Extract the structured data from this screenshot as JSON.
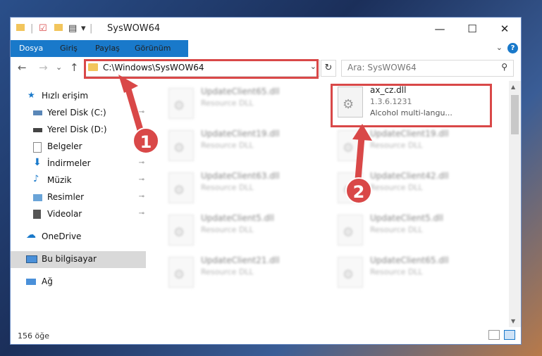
{
  "window": {
    "title": "SysWOW64",
    "quick_access_dropdown": "▾",
    "controls": {
      "minimize": "—",
      "maximize": "☐",
      "close": "✕"
    }
  },
  "ribbon": {
    "tabs": [
      {
        "label": "Dosya"
      },
      {
        "label": "Giriş"
      },
      {
        "label": "Paylaş"
      },
      {
        "label": "Görünüm"
      }
    ],
    "help": "?",
    "expand": "⌄"
  },
  "navigation": {
    "back": "←",
    "forward": "→",
    "recent": "⌄",
    "up": "↑",
    "address": "C:\\Windows\\SysWOW64",
    "address_dropdown": "⌄",
    "refresh": "↻",
    "search_placeholder": "Ara: SysWOW64",
    "search_icon": "⚲"
  },
  "sidebar": {
    "items": [
      {
        "label": "Hızlı erişim",
        "icon": "star-icon",
        "pinned": false
      },
      {
        "label": "Yerel Disk (C:)",
        "icon": "drive-icon",
        "pinned": true
      },
      {
        "label": "Yerel Disk (D:)",
        "icon": "drive-icon",
        "pinned": true
      },
      {
        "label": "Belgeler",
        "icon": "documents-icon",
        "pinned": true
      },
      {
        "label": "İndirmeler",
        "icon": "download-icon",
        "pinned": true
      },
      {
        "label": "Müzik",
        "icon": "music-icon",
        "pinned": true
      },
      {
        "label": "Resimler",
        "icon": "pictures-icon",
        "pinned": true
      },
      {
        "label": "Videolar",
        "icon": "video-icon",
        "pinned": true
      },
      {
        "label": "OneDrive",
        "icon": "cloud-icon",
        "pinned": false
      },
      {
        "label": "Bu bilgisayar",
        "icon": "computer-icon",
        "pinned": false,
        "selected": true
      },
      {
        "label": "Ağ",
        "icon": "network-icon",
        "pinned": false
      }
    ],
    "pin_glyph": "📌"
  },
  "files": [
    {
      "name": "UpdateClient65.dll",
      "type": "Resource DLL",
      "blurred": true
    },
    {
      "name": "ax_cz.dll",
      "version": "1.3.6.1231",
      "description": "Alcohol multi-langu...",
      "blurred": false,
      "highlighted": true
    },
    {
      "name": "UpdateClient19.dll",
      "type": "Resource DLL",
      "blurred": true
    },
    {
      "name": "UpdateClient19.dll",
      "type": "Resource DLL",
      "blurred": true
    },
    {
      "name": "UpdateClient63.dll",
      "type": "Resource DLL",
      "blurred": true
    },
    {
      "name": "UpdateClient42.dll",
      "type": "Resource DLL",
      "blurred": true
    },
    {
      "name": "UpdateClient5.dll",
      "type": "Resource DLL",
      "blurred": true
    },
    {
      "name": "UpdateClient5.dll",
      "type": "Resource DLL",
      "blurred": true
    },
    {
      "name": "UpdateClient21.dll",
      "type": "Resource DLL",
      "blurred": true
    },
    {
      "name": "UpdateClient65.dll",
      "type": "Resource DLL",
      "blurred": true
    }
  ],
  "status": {
    "count": "156 öğe"
  },
  "annotations": [
    {
      "number": "1"
    },
    {
      "number": "2"
    }
  ],
  "colors": {
    "accent": "#1979ca",
    "highlight": "#d94848",
    "folder": "#f2c55c"
  }
}
